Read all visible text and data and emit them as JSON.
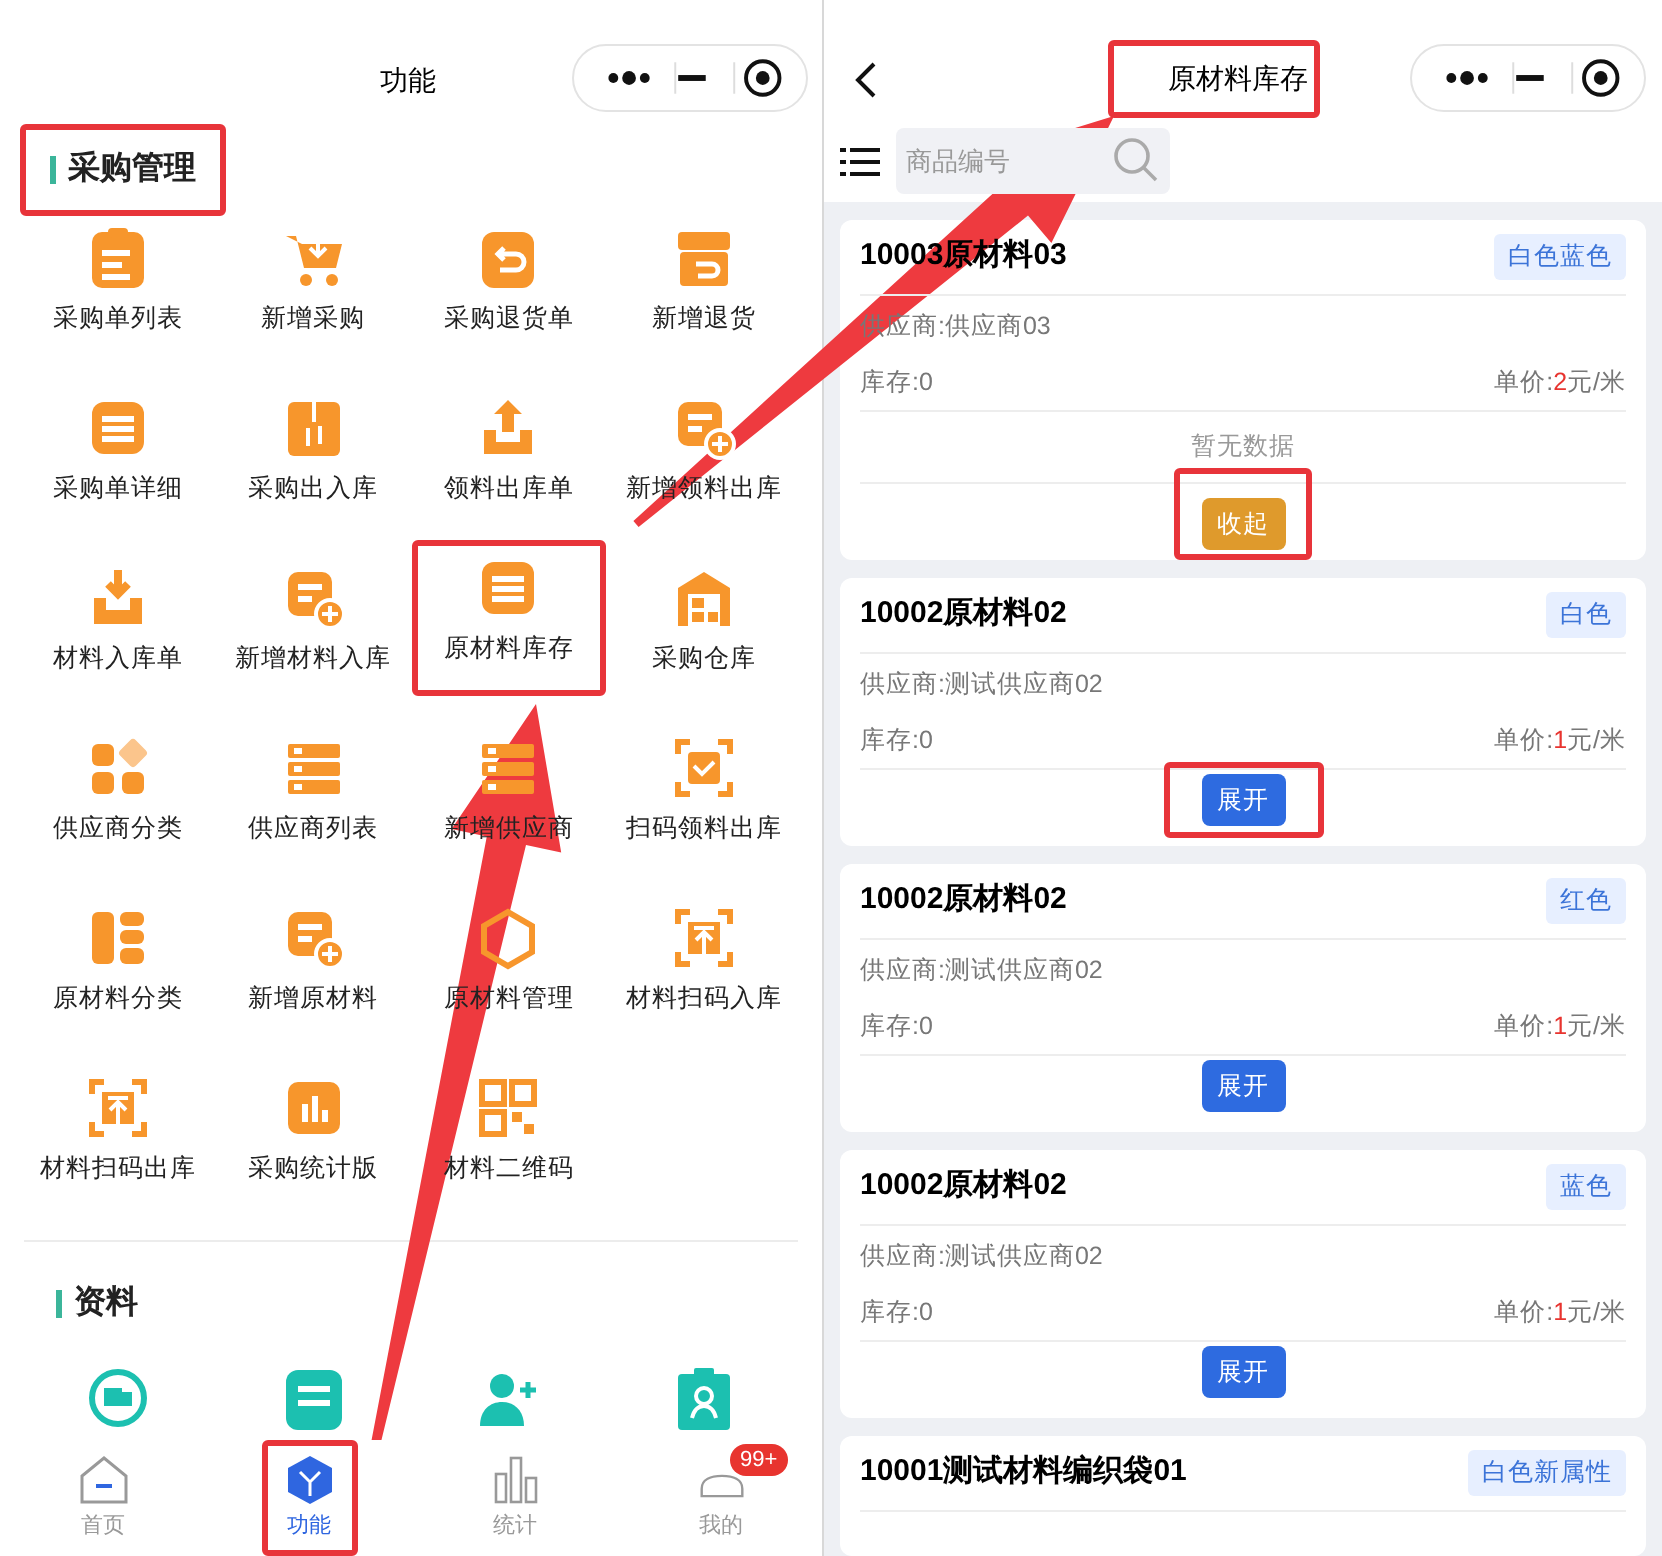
{
  "left_screen": {
    "title": "功能",
    "purchase_section": {
      "title": "采购管理",
      "highlighted": true
    },
    "purchase_items": [
      {
        "label": "采购单列表",
        "highlighted": false
      },
      {
        "label": "新增采购",
        "highlighted": false
      },
      {
        "label": "采购退货单",
        "highlighted": false
      },
      {
        "label": "新增退货",
        "highlighted": false
      },
      {
        "label": "采购单详细",
        "highlighted": false
      },
      {
        "label": "采购出入库",
        "highlighted": false
      },
      {
        "label": "领料出库单",
        "highlighted": false
      },
      {
        "label": "新增领料出库",
        "highlighted": false
      },
      {
        "label": "材料入库单",
        "highlighted": false
      },
      {
        "label": "新增材料入库",
        "highlighted": false
      },
      {
        "label": "原材料库存",
        "highlighted": true
      },
      {
        "label": "采购仓库",
        "highlighted": false
      },
      {
        "label": "供应商分类",
        "highlighted": false
      },
      {
        "label": "供应商列表",
        "highlighted": false
      },
      {
        "label": "新增供应商",
        "highlighted": false
      },
      {
        "label": "扫码领料出库",
        "highlighted": false
      },
      {
        "label": "原材料分类",
        "highlighted": false
      },
      {
        "label": "新增原材料",
        "highlighted": false
      },
      {
        "label": "原材料管理",
        "highlighted": false
      },
      {
        "label": "材料扫码入库",
        "highlighted": false
      },
      {
        "label": "材料扫码出库",
        "highlighted": false
      },
      {
        "label": "采购统计版",
        "highlighted": false
      },
      {
        "label": "材料二维码",
        "highlighted": false
      }
    ],
    "data_section": {
      "title": "资料"
    },
    "tab_bar": [
      {
        "label": "首页",
        "selected": false,
        "highlighted": false
      },
      {
        "label": "功能",
        "selected": true,
        "highlighted": true
      },
      {
        "label": "统计",
        "selected": false,
        "highlighted": false
      },
      {
        "label": "我的",
        "selected": false,
        "highlighted": false,
        "badge": "99+"
      }
    ]
  },
  "right_screen": {
    "title": "原材料库存",
    "title_highlighted": true,
    "search": {
      "placeholder": "商品编号"
    },
    "cards": [
      {
        "title": "10003原材料03",
        "tag": "白色蓝色",
        "supplier": "供应商:供应商03",
        "stock": "库存:0",
        "price_label": "单价:",
        "price_value": "2",
        "price_unit": "元/米",
        "expanded": true,
        "empty_text": "暂无数据",
        "button": "收起",
        "highlighted": true
      },
      {
        "title": "10002原材料02",
        "tag": "白色",
        "supplier": "供应商:测试供应商02",
        "stock": "库存:0",
        "price_label": "单价:",
        "price_value": "1",
        "price_unit": "元/米",
        "expanded": false,
        "button": "展开",
        "highlighted": true
      },
      {
        "title": "10002原材料02",
        "tag": "红色",
        "supplier": "供应商:测试供应商02",
        "stock": "库存:0",
        "price_label": "单价:",
        "price_value": "1",
        "price_unit": "元/米",
        "expanded": false,
        "button": "展开",
        "highlighted": false
      },
      {
        "title": "10002原材料02",
        "tag": "蓝色",
        "supplier": "供应商:测试供应商02",
        "stock": "库存:0",
        "price_label": "单价:",
        "price_value": "1",
        "price_unit": "元/米",
        "expanded": false,
        "button": "展开",
        "highlighted": false
      },
      {
        "title": "10001测试材料编织袋01",
        "tag": "白色新属性"
      }
    ]
  }
}
